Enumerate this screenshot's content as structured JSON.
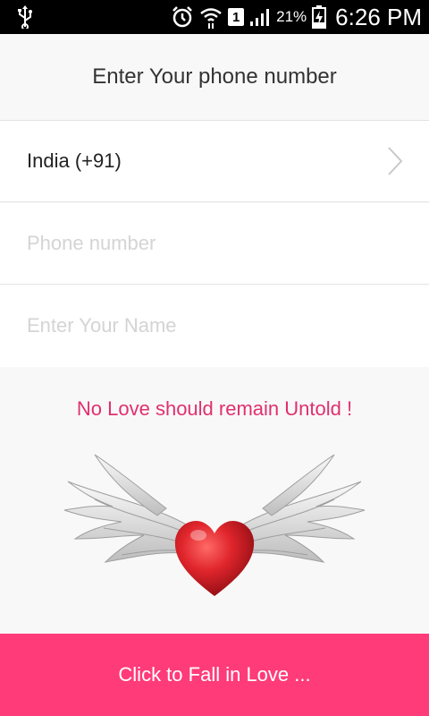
{
  "status_bar": {
    "usb_icon": "usb-icon",
    "alarm_icon": "alarm-icon",
    "wifi_icon": "wifi-icon",
    "sim_slot": "1",
    "signal_icon": "signal-icon",
    "battery_percent": "21%",
    "battery_icon": "battery-charging-icon",
    "time": "6:26 PM"
  },
  "header": {
    "title": "Enter Your phone number"
  },
  "form": {
    "country": {
      "label": "India (+91)",
      "chevron_icon": "chevron-right-icon"
    },
    "phone": {
      "value": "",
      "placeholder": "Phone number"
    },
    "name": {
      "value": "",
      "placeholder": "Enter Your Name"
    }
  },
  "promo": {
    "tagline": "No Love should remain Untold !",
    "image": "winged-heart-image"
  },
  "cta": {
    "label": "Click to Fall in Love ..."
  },
  "colors": {
    "accent": "#ff3b7a",
    "tagline": "#e0306e",
    "heart": "#d81f26",
    "status_bar": "#000000",
    "background": "#f8f8f8"
  }
}
